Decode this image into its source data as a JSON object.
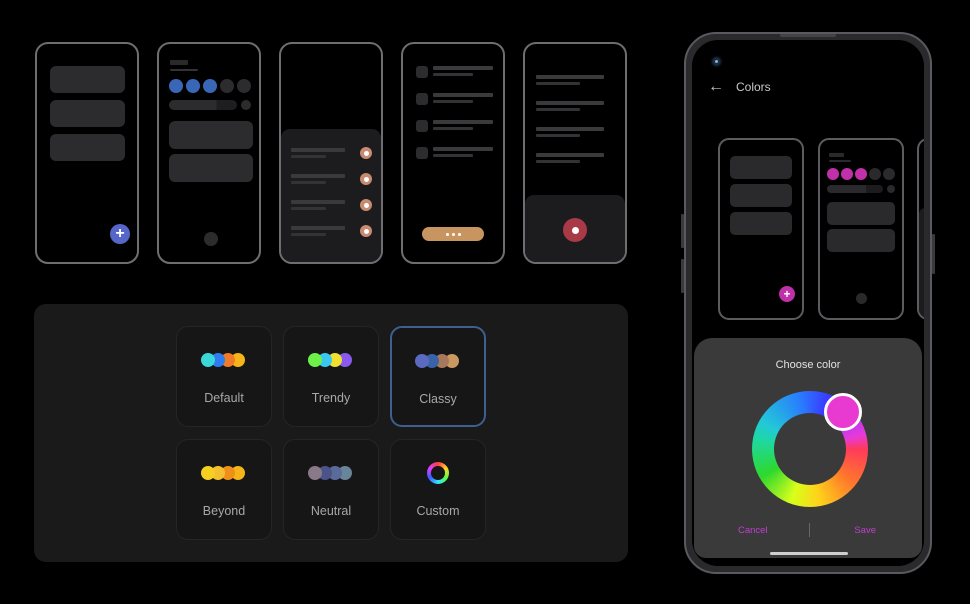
{
  "wireframes": {
    "screen1": {
      "fab_icon": "plus-icon",
      "fab_glyph": "+",
      "accent": "#5566c8"
    },
    "screen2": {
      "accent": "#3a66b8"
    },
    "screen3": {
      "accent": "#c68b70"
    },
    "screen4": {
      "accent": "#c89561"
    },
    "screen5": {
      "accent": "#a83a48"
    }
  },
  "theme_panel": {
    "selected": "Classy",
    "themes": [
      {
        "label": "Default",
        "colors": [
          "#3ad8d8",
          "#2f7cf0",
          "#f07a28",
          "#f5b418"
        ]
      },
      {
        "label": "Trendy",
        "colors": [
          "#6ef04a",
          "#3ac8f0",
          "#f0e030",
          "#8a5af0"
        ]
      },
      {
        "label": "Classy",
        "colors": [
          "#5a6ac0",
          "#3a62a8",
          "#a8785a",
          "#c89a62"
        ]
      },
      {
        "label": "Beyond",
        "colors": [
          "#f5d020",
          "#f5c030",
          "#f0901a",
          "#f5b418"
        ]
      },
      {
        "label": "Neutral",
        "colors": [
          "#8a7a88",
          "#4a5488",
          "#5a6a9a",
          "#6a849a"
        ]
      },
      {
        "label": "Custom",
        "icon": "color-ring-icon"
      }
    ]
  },
  "phone": {
    "app_bar": {
      "back_icon": "←",
      "title": "Colors"
    },
    "preview_accent": "#c030a8",
    "fab_glyph": "+",
    "color_dialog": {
      "title": "Choose color",
      "selected_color": "#e83ad0",
      "cancel_label": "Cancel",
      "save_label": "Save"
    }
  }
}
